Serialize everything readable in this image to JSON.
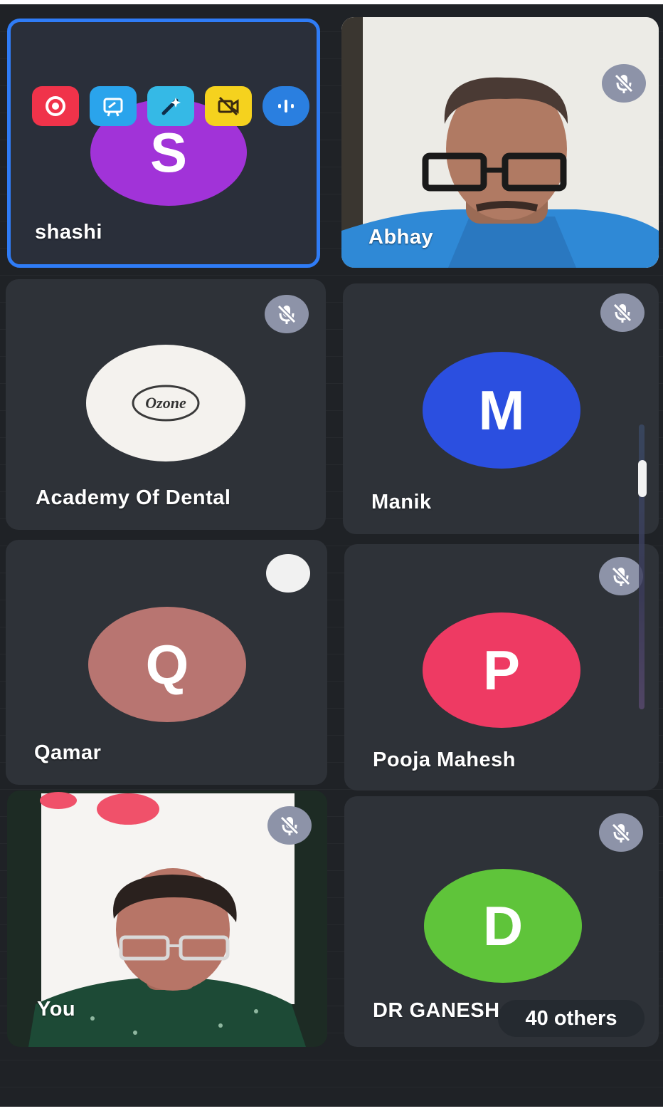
{
  "colors": {
    "background": "#1f2226",
    "tile": "#2e3238",
    "active_border": "#2f7cf6",
    "mute_badge": "#8d93a8"
  },
  "toolbar": {
    "buttons": [
      {
        "icon": "record-icon",
        "color": "#f0334a"
      },
      {
        "icon": "whiteboard-icon",
        "color": "#2aa4ec"
      },
      {
        "icon": "magic-pen-icon",
        "color": "#35b9e6"
      },
      {
        "icon": "video-off-icon",
        "color": "#f5d21e"
      },
      {
        "icon": "audio-bars-icon",
        "color": "#2a7fe0"
      }
    ]
  },
  "participants": [
    {
      "name": "shashi",
      "initial": "S",
      "avatar_color": "#a133d8",
      "active": true,
      "muted": false
    },
    {
      "name": "Abhay",
      "video": true,
      "muted": true
    },
    {
      "name": "Academy Of Dental",
      "logo_text": "Ozone",
      "muted": true
    },
    {
      "name": "Manik",
      "initial": "M",
      "avatar_color": "#2b4fe0",
      "muted": true
    },
    {
      "name": "Qamar",
      "initial": "Q",
      "avatar_color": "#b87571",
      "muted": false
    },
    {
      "name": "Pooja Mahesh",
      "initial": "P",
      "avatar_color": "#ee3a63",
      "muted": true
    },
    {
      "name": "You",
      "video": true,
      "muted": true
    },
    {
      "name": "DR GANESH",
      "initial": "D",
      "avatar_color": "#5fc43a",
      "muted": true
    }
  ],
  "others_label": "40 others"
}
